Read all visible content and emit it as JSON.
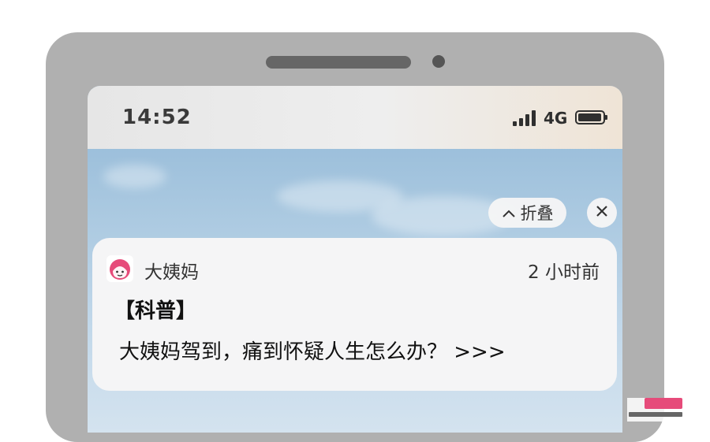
{
  "status_bar": {
    "time": "14:52",
    "network": "4G"
  },
  "controls": {
    "collapse_label": "折叠",
    "collapse_icon": "chevron-up-icon",
    "close_icon": "close-icon"
  },
  "notification": {
    "app_name": "大姨妈",
    "app_icon": "app-logo-icon",
    "time_ago": "2 小时前",
    "title": "【科普】",
    "body": "大姨妈驾到，痛到怀疑人生怎么办？ >>>"
  },
  "colors": {
    "brand_pink": "#e64b7a",
    "card_bg": "#f5f5f6",
    "frame": "#b0b0b0"
  }
}
